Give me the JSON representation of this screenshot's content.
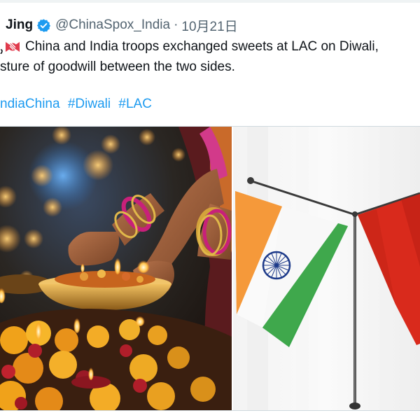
{
  "tweet": {
    "author_name": "Jing",
    "handle": "@ChinaSpox_India",
    "separator": "·",
    "date": "10月21日",
    "text_line1": "China and India troops exchanged sweets at LAC on Diwali,",
    "text_line2": "sture of goodwill between the two sides.",
    "hashtags": [
      "ndiaChina",
      "#Diwali",
      "#LAC"
    ]
  },
  "colors": {
    "hashtag": "#1d9bf0",
    "verified_badge": "#1d9bf0",
    "meta_text": "#536471"
  },
  "icons": {
    "verified": "verified-badge-icon",
    "candy": "candy-emoji-icon"
  }
}
